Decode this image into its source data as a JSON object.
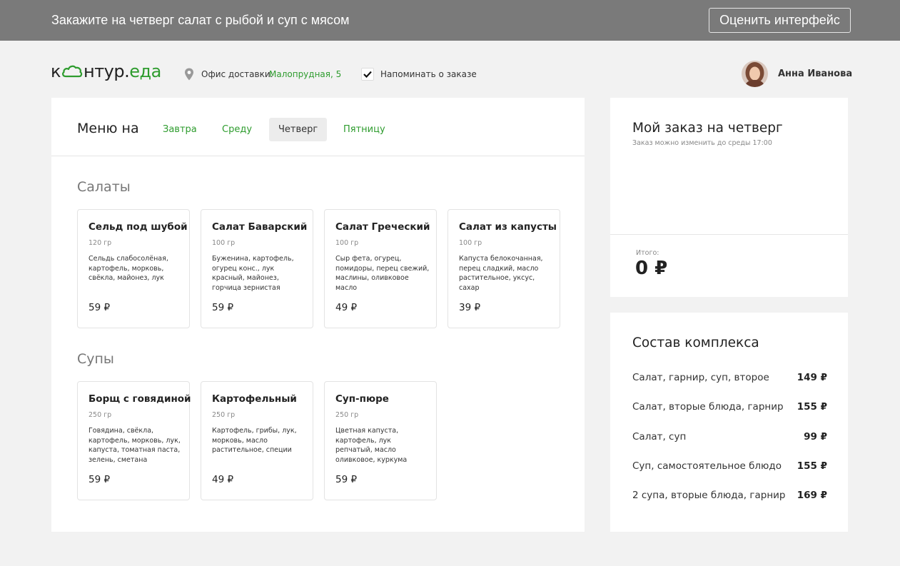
{
  "task": {
    "text": "Закажите на четверг салат с рыбой и суп с мясом",
    "rate_button": "Оценить интерфейс"
  },
  "header": {
    "logo_prefix": "к",
    "logo_middle": "нтур.",
    "logo_suffix": "еда",
    "office_label": "Офис доставки:",
    "office_value": "Малопрудная, 5",
    "remind_label": "Напоминать о заказе",
    "remind_checked": true,
    "user_name": "Анна Иванова"
  },
  "menu": {
    "title": "Меню на",
    "tabs": [
      {
        "label": "Завтра",
        "active": false
      },
      {
        "label": "Среду",
        "active": false
      },
      {
        "label": "Четверг",
        "active": true
      },
      {
        "label": "Пятницу",
        "active": false
      }
    ],
    "sections": [
      {
        "title": "Салаты",
        "items": [
          {
            "name": "Сельд под шубой",
            "weight": "120 гр",
            "desc": "Сельдь слабосолёная, картофель, морковь, свёкла, майонез, лук",
            "price": "59 ₽"
          },
          {
            "name": "Салат Баварский",
            "weight": "100 гр",
            "desc": "Буженина, картофель, огурец конс., лук красный, майонез, горчица зернистая",
            "price": "59 ₽"
          },
          {
            "name": "Салат Греческий",
            "weight": "100 гр",
            "desc": "Сыр фета, огурец, помидоры, перец свежий, маслины, оливковое масло",
            "price": "49 ₽"
          },
          {
            "name": "Салат из капусты",
            "weight": "100 гр",
            "desc": "Капуста белокочанная, перец сладкий, масло растительное, уксус, сахар",
            "price": "39 ₽"
          }
        ]
      },
      {
        "title": "Супы",
        "items": [
          {
            "name": "Борщ с говядиной",
            "weight": "250 гр",
            "desc": "Говядина, свёкла, картофель, морковь, лук, капуста, томатная паста, зелень, сметана",
            "price": "59 ₽"
          },
          {
            "name": "Картофельный",
            "weight": "250 гр",
            "desc": "Картофель, грибы, лук, морковь, масло растительное, специи",
            "price": "49 ₽"
          },
          {
            "name": "Суп-пюре",
            "weight": "250 гр",
            "desc": "Цветная капуста, картофель, лук репчатый, масло оливковое, куркума",
            "price": "59 ₽"
          }
        ]
      }
    ]
  },
  "order": {
    "title": "Мой заказ на четверг",
    "subtitle": "Заказ можно изменить до среды 17:00",
    "total_label": "Итого:",
    "total_value": "0 ₽"
  },
  "combos": {
    "title": "Состав комплекса",
    "items": [
      {
        "name": "Салат, гарнир, суп, второе",
        "price": "149 ₽"
      },
      {
        "name": "Салат, вторые блюда, гарнир",
        "price": "155 ₽"
      },
      {
        "name": "Салат, суп",
        "price": "99 ₽"
      },
      {
        "name": "Суп, самостоятельное блюдо",
        "price": "155 ₽"
      },
      {
        "name": "2 супа, вторые блюда, гарнир",
        "price": "169 ₽"
      }
    ]
  },
  "colors": {
    "accent_green": "#2e9c2e",
    "task_bar": "#7a7a7a",
    "background": "#f2f2f2"
  }
}
